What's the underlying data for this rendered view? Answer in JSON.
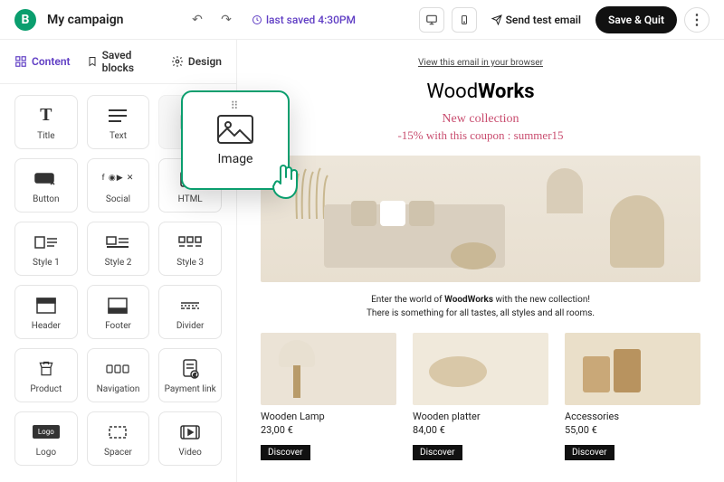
{
  "header": {
    "logo_letter": "B",
    "title": "My campaign",
    "last_saved": "last saved 4:30PM",
    "send_test": "Send test email",
    "save_quit": "Save & Quit"
  },
  "tabs": {
    "content": "Content",
    "saved_blocks": "Saved blocks",
    "design": "Design"
  },
  "blocks": {
    "title": "Title",
    "text": "Text",
    "image_ghost": "",
    "button": "Button",
    "social": "Social",
    "html": "HTML",
    "style1": "Style 1",
    "style2": "Style 2",
    "style3": "Style 3",
    "header": "Header",
    "footer": "Footer",
    "divider": "Divider",
    "product": "Product",
    "navigation": "Navigation",
    "payment": "Payment link",
    "logo": "Logo",
    "spacer": "Spacer",
    "video": "Video"
  },
  "drag": {
    "label": "Image"
  },
  "email": {
    "browser_link": "View this email in your browser",
    "brand_thin": "Wood",
    "brand_bold": "Works",
    "promo_title": "New collection",
    "promo_sub": "-15% with this coupon : summer15",
    "intro_pre": "Enter the world of ",
    "intro_brand": "WoodWorks",
    "intro_post": " with the new collection!",
    "intro_line2": "There is something for all tastes, all styles and all rooms.",
    "products": [
      {
        "name": "Wooden Lamp",
        "price": "23,00 €",
        "cta": "Discover"
      },
      {
        "name": "Wooden platter",
        "price": "84,00 €",
        "cta": "Discover"
      },
      {
        "name": "Accessories",
        "price": "55,00 €",
        "cta": "Discover"
      }
    ]
  }
}
